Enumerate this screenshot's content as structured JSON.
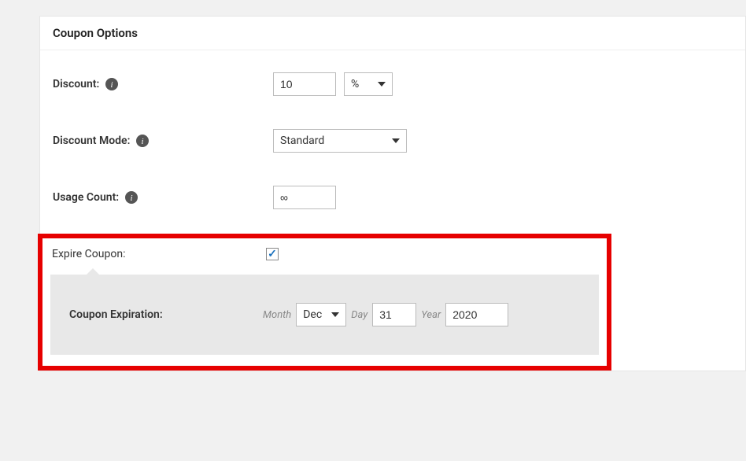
{
  "panel": {
    "title": "Coupon Options"
  },
  "discount": {
    "label": "Discount:",
    "value": "10",
    "unit_selected": "%"
  },
  "discount_mode": {
    "label": "Discount Mode:",
    "selected": "Standard"
  },
  "usage_count": {
    "label": "Usage Count:",
    "value": "∞"
  },
  "expire_coupon": {
    "label": "Expire Coupon:",
    "checked": true
  },
  "coupon_expiration": {
    "label": "Coupon Expiration:",
    "month_label": "Month",
    "month_value": "Dec",
    "day_label": "Day",
    "day_value": "31",
    "year_label": "Year",
    "year_value": "2020"
  }
}
